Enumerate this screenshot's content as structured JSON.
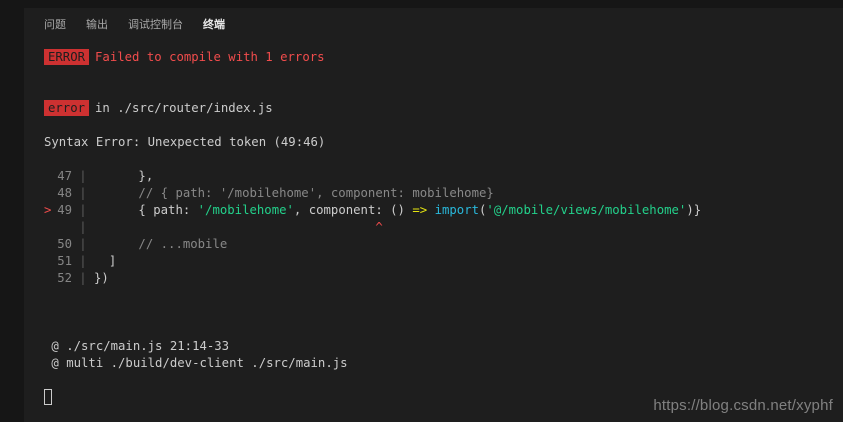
{
  "tabs": [
    {
      "label": "问题"
    },
    {
      "label": "输出"
    },
    {
      "label": "调试控制台"
    },
    {
      "label": "终端"
    }
  ],
  "terminal": {
    "error_badge": "ERROR",
    "compile_msg": "Failed to compile with 1 errors",
    "error_badge2": "error",
    "file_msg": "in ./src/router/index.js",
    "syntax_error": "Syntax Error: Unexpected token (49:46)",
    "code": {
      "marker": ">",
      "l47_num": "47",
      "l47_text": "},",
      "l48_num": "48",
      "l48_text": "// { path: '/mobilehome', component: mobilehome}",
      "l49_num": "49",
      "l49_open": "{ path: ",
      "l49_str1": "'/mobilehome'",
      "l49_mid": ", component: () ",
      "l49_arrow": "=>",
      "l49_import": "import",
      "l49_paren_open": "(",
      "l49_str2": "'@/mobile/views/mobilehome'",
      "l49_close": ")}",
      "caret": "^",
      "l50_num": "50",
      "l50_text": "// ...mobile",
      "l51_num": "51",
      "l51_text": "]",
      "l52_num": "52",
      "l52_text": "})"
    },
    "stack1": " @ ./src/main.js 21:14-33",
    "stack2": " @ multi ./build/dev-client ./src/main.js"
  },
  "watermark": "https://blog.csdn.net/xyphf"
}
